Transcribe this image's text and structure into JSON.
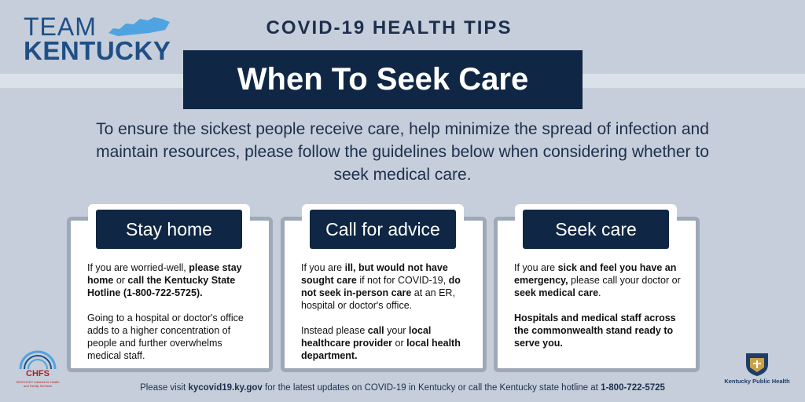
{
  "logo": {
    "team": "TEAM",
    "kentucky": "KENTUCKY"
  },
  "subtitle": "COVID-19 HEALTH TIPS",
  "title": "When To Seek Care",
  "intro": "To ensure the sickest people receive care, help minimize the spread of infection and maintain resources, please follow the guidelines below when considering whether to seek medical care.",
  "cards": [
    {
      "label": "Stay home",
      "p1": [
        {
          "t": "If you are worried-well, ",
          "b": false
        },
        {
          "t": "please stay home",
          "b": true
        },
        {
          "t": " or ",
          "b": false
        },
        {
          "t": "call the Kentucky State Hotline (1-800-722-5725).",
          "b": true
        }
      ],
      "p2": [
        {
          "t": "Going to a hospital or doctor's office adds to a higher concentration of people and further overwhelms medical staff.",
          "b": false
        }
      ]
    },
    {
      "label": "Call for advice",
      "p1": [
        {
          "t": "If you are ",
          "b": false
        },
        {
          "t": "ill, but would not have sought care",
          "b": true
        },
        {
          "t": " if not for COVID-19, ",
          "b": false
        },
        {
          "t": "do not seek in-person care",
          "b": true
        },
        {
          "t": " at an ER, hospital or doctor's office.",
          "b": false
        }
      ],
      "p2": [
        {
          "t": "Instead please ",
          "b": false
        },
        {
          "t": "call",
          "b": true
        },
        {
          "t": " your ",
          "b": false
        },
        {
          "t": "local healthcare provider",
          "b": true
        },
        {
          "t": " or ",
          "b": false
        },
        {
          "t": "local health department.",
          "b": true
        }
      ]
    },
    {
      "label": "Seek care",
      "p1": [
        {
          "t": "If you are ",
          "b": false
        },
        {
          "t": "sick and feel you have an emergency,",
          "b": true
        },
        {
          "t": " please call your doctor or ",
          "b": false
        },
        {
          "t": "seek medical care",
          "b": true
        },
        {
          "t": ".",
          "b": false
        }
      ],
      "p2": [
        {
          "t": "Hospitals and medical staff across the commonwealth stand ready to serve you.",
          "b": true
        }
      ]
    }
  ],
  "footer": [
    {
      "t": "Please visit ",
      "b": false
    },
    {
      "t": "kycovid19.ky.gov",
      "b": true
    },
    {
      "t": " for the latest updates on COVID-19 in Kentucky or call the Kentucky state hotline at ",
      "b": false
    },
    {
      "t": "1-800-722-5725",
      "b": true
    }
  ],
  "chfs": {
    "name": "CHFS",
    "sub": "KENTUCKY Cabinet for Health and Family Services"
  },
  "kph": {
    "name": "Kentucky Public Health"
  },
  "colors": {
    "navy": "#0f2744",
    "background": "#c5ceda",
    "accent": "#1f4f86",
    "card_border": "#9ea9b7"
  }
}
